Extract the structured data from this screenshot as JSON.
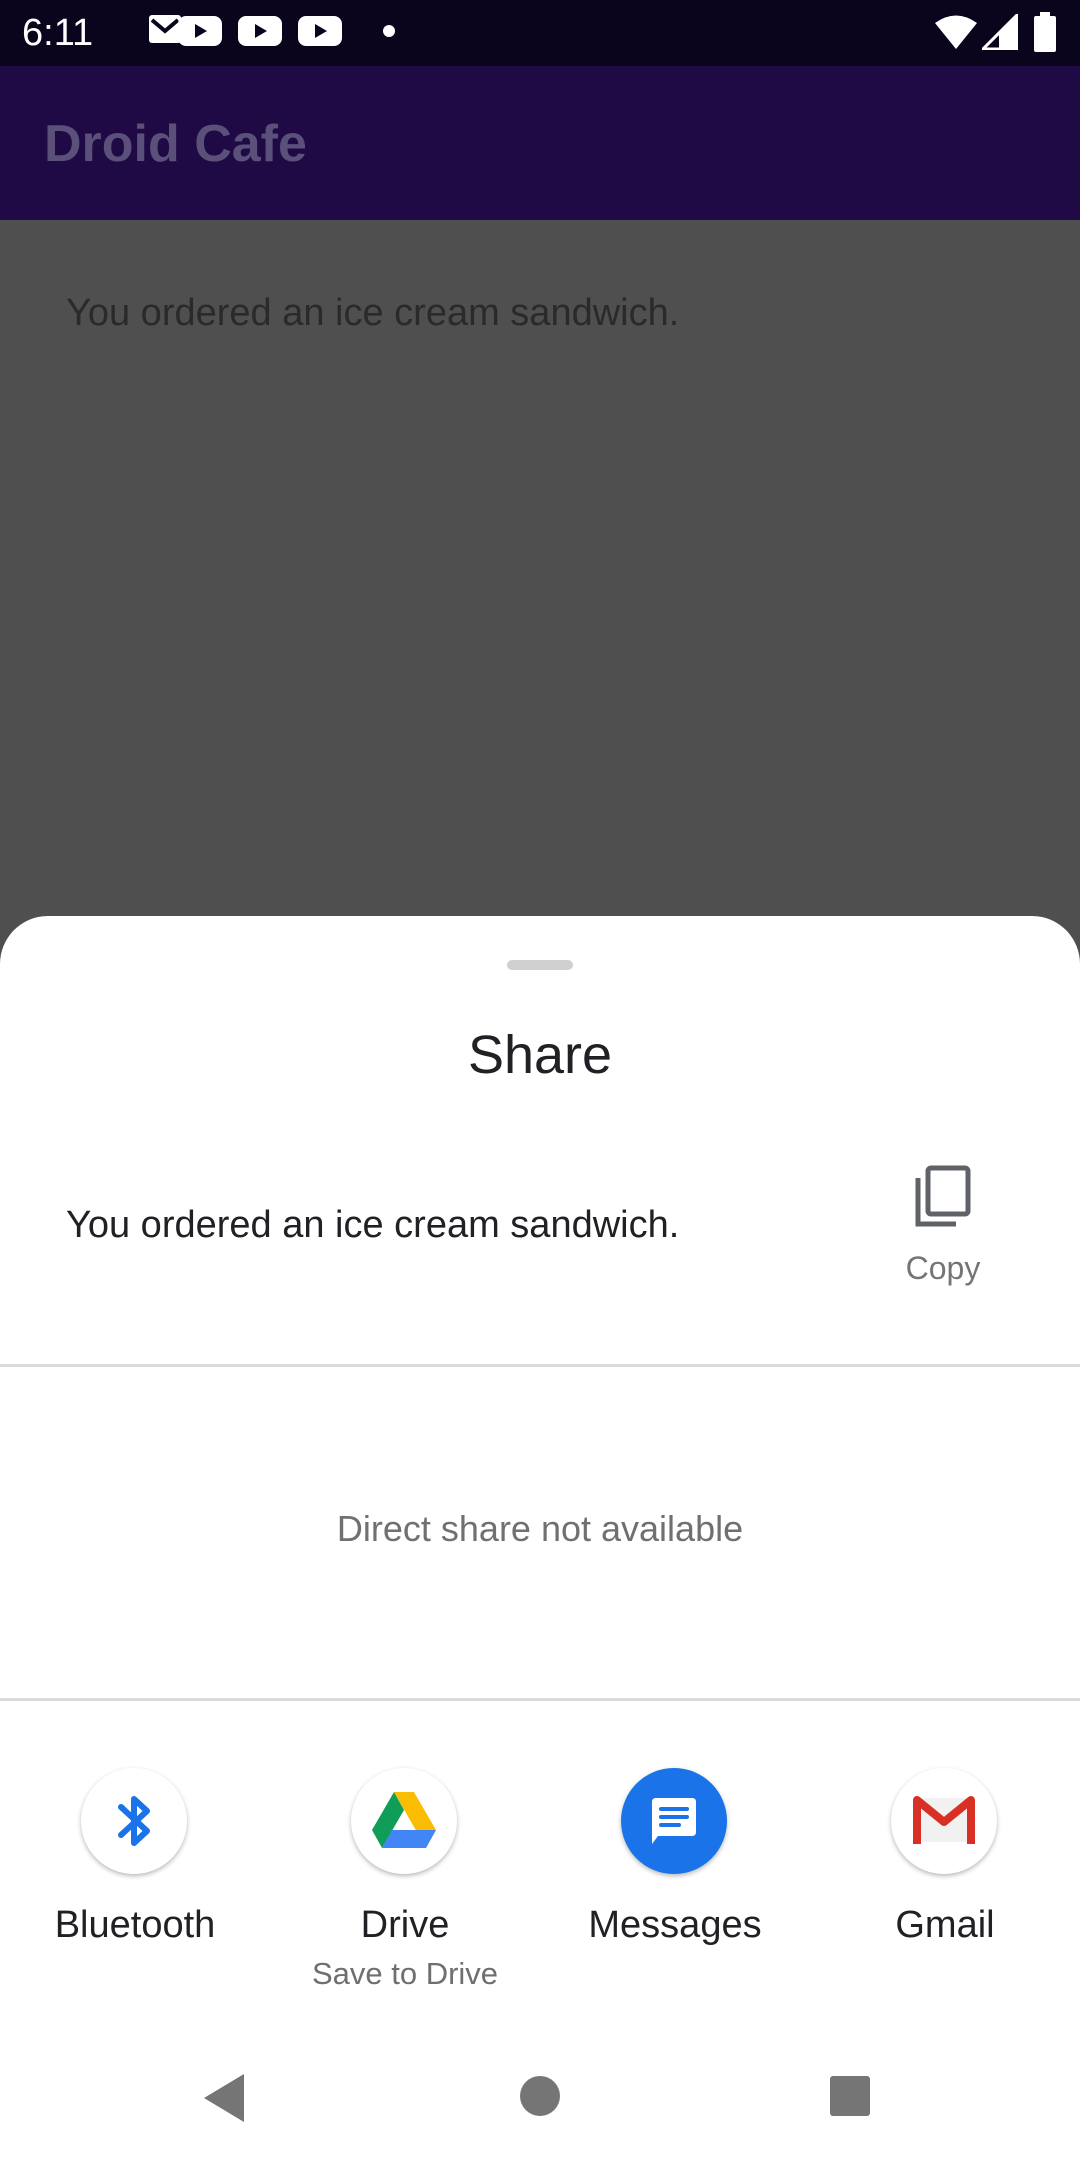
{
  "status_bar": {
    "time": "6:11",
    "notification_icons": [
      "gmail-icon",
      "youtube-icon",
      "youtube-icon",
      "youtube-icon",
      "dot-icon"
    ],
    "system_icons": [
      "wifi-icon",
      "signal-icon",
      "battery-icon"
    ]
  },
  "app_bar": {
    "title": "Droid Cafe"
  },
  "main": {
    "order_text": "You ordered an ice cream sandwich."
  },
  "share_sheet": {
    "title": "Share",
    "shared_text": "You ordered an ice cream sandwich.",
    "copy_label": "Copy",
    "direct_share_message": "Direct share not available",
    "targets": [
      {
        "label": "Bluetooth",
        "sublabel": "",
        "icon": "bluetooth-icon"
      },
      {
        "label": "Drive",
        "sublabel": "Save to Drive",
        "icon": "google-drive-icon"
      },
      {
        "label": "Messages",
        "sublabel": "",
        "icon": "messages-icon"
      },
      {
        "label": "Gmail",
        "sublabel": "",
        "icon": "gmail-icon"
      }
    ]
  },
  "nav_bar": {
    "buttons": [
      "back-icon",
      "home-icon",
      "recents-icon"
    ]
  },
  "colors": {
    "status_bar": "#0b041d",
    "app_bar": "#1f0a45",
    "scrim_content": "#4f4f4f",
    "messages_blue": "#1a73e8",
    "bluetooth_blue": "#1a73e8",
    "gmail_red": "#d93025"
  }
}
